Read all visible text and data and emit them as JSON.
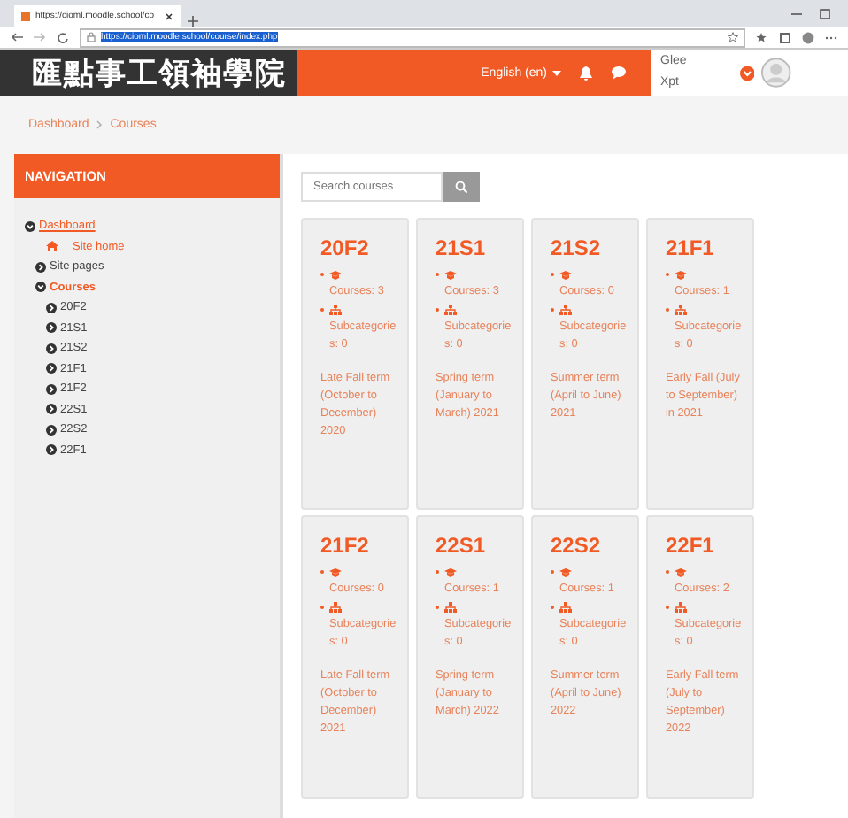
{
  "browser": {
    "tab_title": "https://cioml.moodle.school/co",
    "url": "https://cioml.moodle.school/course/index.php"
  },
  "header": {
    "logo": "匯點事工領袖學院",
    "language": "English (en)",
    "user_first": "Glee",
    "user_last": "Xpt"
  },
  "breadcrumb": [
    "Dashboard",
    "Courses"
  ],
  "navigation": {
    "title": "NAVIGATION",
    "items": [
      {
        "label": "Dashboard",
        "kind": "link",
        "current": false,
        "expanded": true,
        "children": [
          {
            "label": "Site home",
            "kind": "home",
            "current": false
          },
          {
            "label": "Site pages",
            "kind": "branch",
            "current": false,
            "expanded": false
          },
          {
            "label": "Courses",
            "kind": "branch",
            "current": true,
            "expanded": true,
            "children": [
              {
                "label": "20F2",
                "kind": "branch",
                "current": false,
                "expanded": false
              },
              {
                "label": "21S1",
                "kind": "branch",
                "current": false,
                "expanded": false
              },
              {
                "label": "21S2",
                "kind": "branch",
                "current": false,
                "expanded": false
              },
              {
                "label": "21F1",
                "kind": "branch",
                "current": false,
                "expanded": false
              },
              {
                "label": "21F2",
                "kind": "branch",
                "current": false,
                "expanded": false
              },
              {
                "label": "22S1",
                "kind": "branch",
                "current": false,
                "expanded": false
              },
              {
                "label": "22S2",
                "kind": "branch",
                "current": false,
                "expanded": false
              },
              {
                "label": "22F1",
                "kind": "branch",
                "current": false,
                "expanded": false
              }
            ]
          }
        ]
      }
    ]
  },
  "search": {
    "placeholder": "Search courses"
  },
  "categories": [
    {
      "name": "20F2",
      "courses": "Courses: 3",
      "subcategories": "Subcategories: 0",
      "description": "Late Fall term (October to December) 2020"
    },
    {
      "name": "21S1",
      "courses": "Courses: 3",
      "subcategories": "Subcategories: 0",
      "description": "Spring term (January to March) 2021"
    },
    {
      "name": "21S2",
      "courses": "Courses: 0",
      "subcategories": "Subcategories: 0",
      "description": "Summer term (April to June) 2021"
    },
    {
      "name": "21F1",
      "courses": "Courses: 1",
      "subcategories": "Subcategories: 0",
      "description": "Early Fall (July to September) in 2021"
    },
    {
      "name": "21F2",
      "courses": "Courses: 0",
      "subcategories": "Subcategories: 0",
      "description": "Late Fall term (October to December) 2021"
    },
    {
      "name": "22S1",
      "courses": "Courses: 1",
      "subcategories": "Subcategories: 0",
      "description": "Spring term (January to March) 2022"
    },
    {
      "name": "22S2",
      "courses": "Courses: 1",
      "subcategories": "Subcategories: 0",
      "description": "Summer term (April to June) 2022"
    },
    {
      "name": "22F1",
      "courses": "Courses: 2",
      "subcategories": "Subcategories: 0",
      "description": "Early Fall term (July to September) 2022"
    }
  ]
}
